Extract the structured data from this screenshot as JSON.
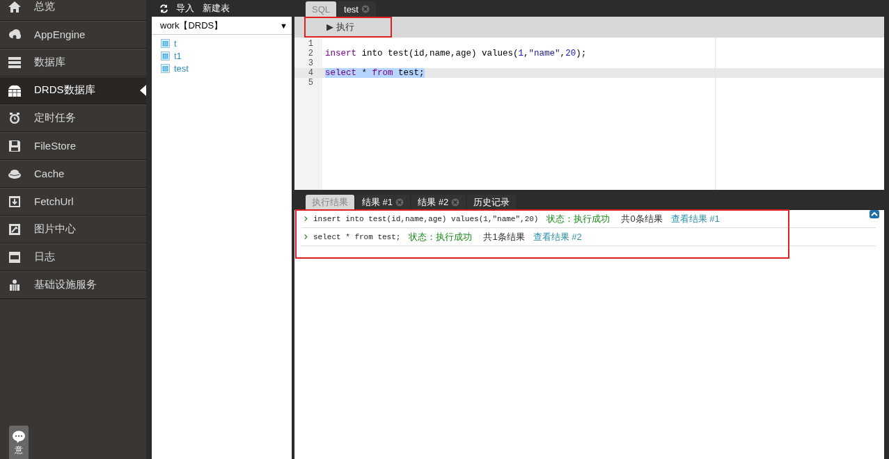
{
  "sidebar": {
    "items": [
      {
        "label": "总览",
        "selected": false
      },
      {
        "label": "AppEngine",
        "selected": false
      },
      {
        "label": "数据库",
        "selected": false
      },
      {
        "label": "DRDS数据库",
        "selected": true
      },
      {
        "label": "定时任务",
        "selected": false
      },
      {
        "label": "FileStore",
        "selected": false
      },
      {
        "label": "Cache",
        "selected": false
      },
      {
        "label": "FetchUrl",
        "selected": false
      },
      {
        "label": "图片中心",
        "selected": false
      },
      {
        "label": "日志",
        "selected": false
      },
      {
        "label": "基础设施服务",
        "selected": false
      }
    ],
    "feedback": {
      "label": "意"
    }
  },
  "explorer": {
    "toolbar": [
      "导入",
      "新建表"
    ],
    "database_select": {
      "value": "work【DRDS】",
      "arrow": "▼"
    },
    "tables": [
      "t",
      "t1",
      "test"
    ]
  },
  "editor": {
    "tabs": [
      {
        "label": "SQL",
        "selected": true,
        "closable": false
      },
      {
        "label": "test",
        "selected": false,
        "closable": true
      }
    ],
    "run_button": {
      "icon": "▶",
      "label": "执行",
      "highlighted": true
    },
    "lines": [
      {
        "number": "1",
        "selected": false
      },
      {
        "number": "2",
        "selected": false,
        "tokens": [
          {
            "kind": "keyword",
            "text": "insert"
          },
          {
            "kind": "plain",
            "text": " into test(id,name,age) values("
          },
          {
            "kind": "number",
            "text": "1"
          },
          {
            "kind": "plain",
            "text": ","
          },
          {
            "kind": "string",
            "text": "\"name\""
          },
          {
            "kind": "plain",
            "text": ","
          },
          {
            "kind": "number",
            "text": "20"
          },
          {
            "kind": "plain",
            "text": ");"
          }
        ]
      },
      {
        "number": "3",
        "selected": false
      },
      {
        "number": "4",
        "selected": true,
        "tokens": [
          {
            "kind": "keyword",
            "text": "select"
          },
          {
            "kind": "plain",
            "text": " * "
          },
          {
            "kind": "keyword",
            "text": "from"
          },
          {
            "kind": "plain",
            "text": " test;"
          }
        ]
      },
      {
        "number": "5",
        "selected": false
      }
    ]
  },
  "results": {
    "tabs": [
      {
        "label": "执行结果",
        "selected": true,
        "closable": false
      },
      {
        "label": "结果 #1",
        "selected": false,
        "closable": true
      },
      {
        "label": "结果 #2",
        "selected": false,
        "closable": true
      },
      {
        "label": "历史记录",
        "selected": false,
        "closable": false
      }
    ],
    "highlighted": true,
    "rows": [
      {
        "query": "insert into test(id,name,age) values(1,\"name\",20)",
        "status": "状态：执行成功",
        "count": "共0条结果",
        "link": "查看结果 #1"
      },
      {
        "query": "select * from test;",
        "status": "状态：执行成功",
        "count": "共1条结果",
        "link": "查看结果 #2"
      }
    ]
  }
}
